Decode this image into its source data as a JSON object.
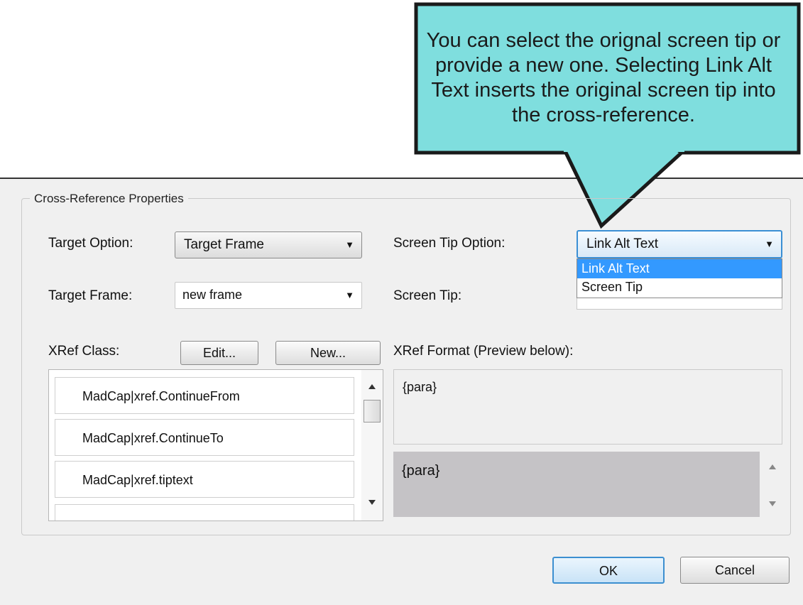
{
  "callout": {
    "text": "You can select the orignal screen tip or provide a new one. Selecting Link Alt Text  inserts the original screen tip into the cross-reference.",
    "fill": "#7fdede"
  },
  "group_title": "Cross-Reference Properties",
  "target_option": {
    "label": "Target Option:",
    "value": "Target Frame"
  },
  "target_frame": {
    "label": "Target Frame:",
    "value": "new frame"
  },
  "screen_tip_option": {
    "label": "Screen Tip Option:",
    "value": "Link Alt Text",
    "options": [
      "Link Alt Text",
      "Screen Tip"
    ],
    "highlight_color": "#3399ff"
  },
  "screen_tip": {
    "label": "Screen Tip:",
    "value": ""
  },
  "xref_class": {
    "label": "XRef Class:",
    "edit_label": "Edit...",
    "new_label": "New...",
    "items": [
      "MadCap|xref.ContinueFrom",
      "MadCap|xref.ContinueTo",
      "MadCap|xref.tiptext"
    ]
  },
  "xref_format": {
    "label": "XRef Format (Preview below):",
    "value": "{para}",
    "preview": "{para}"
  },
  "buttons": {
    "ok": "OK",
    "cancel": "Cancel"
  }
}
